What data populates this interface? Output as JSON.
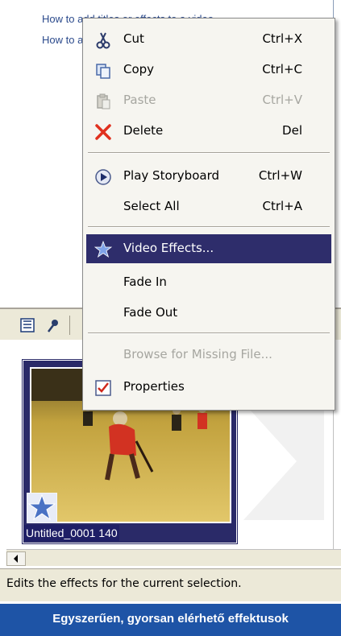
{
  "task_pane": {
    "links": [
      "How to add titles or effects to a video",
      "How to add titles"
    ]
  },
  "context_menu": {
    "items": [
      {
        "label": "Cut",
        "shortcut": "Ctrl+X",
        "icon": "scissors-icon",
        "state": "enabled"
      },
      {
        "label": "Copy",
        "shortcut": "Ctrl+C",
        "icon": "copy-icon",
        "state": "enabled"
      },
      {
        "label": "Paste",
        "shortcut": "Ctrl+V",
        "icon": "paste-icon",
        "state": "disabled"
      },
      {
        "label": "Delete",
        "shortcut": "Del",
        "icon": "delete-x-icon",
        "state": "enabled"
      },
      {
        "label": "Play Storyboard",
        "shortcut": "Ctrl+W",
        "icon": "play-icon",
        "state": "enabled"
      },
      {
        "label": "Select All",
        "shortcut": "Ctrl+A",
        "icon": "",
        "state": "enabled"
      },
      {
        "label": "Video Effects...",
        "shortcut": "",
        "icon": "star-effect-icon",
        "state": "selected"
      },
      {
        "label": "Fade In",
        "shortcut": "",
        "icon": "",
        "state": "enabled"
      },
      {
        "label": "Fade Out",
        "shortcut": "",
        "icon": "",
        "state": "enabled"
      },
      {
        "label": "Browse for Missing File...",
        "shortcut": "",
        "icon": "",
        "state": "disabled"
      },
      {
        "label": "Properties",
        "shortcut": "",
        "icon": "properties-check-icon",
        "state": "enabled"
      }
    ]
  },
  "storyboard": {
    "clip_caption": "Untitled_0001 140"
  },
  "status_bar": {
    "text": "Edits the effects for the current selection."
  },
  "caption": {
    "text": "Egyszerűen, gyorsan elérhető effektusok"
  },
  "colors": {
    "menu_highlight": "#2e2d6b",
    "caption_bar": "#1e54a6",
    "menu_background": "#f6f5f0",
    "disabled_text": "#a6a6a0"
  }
}
